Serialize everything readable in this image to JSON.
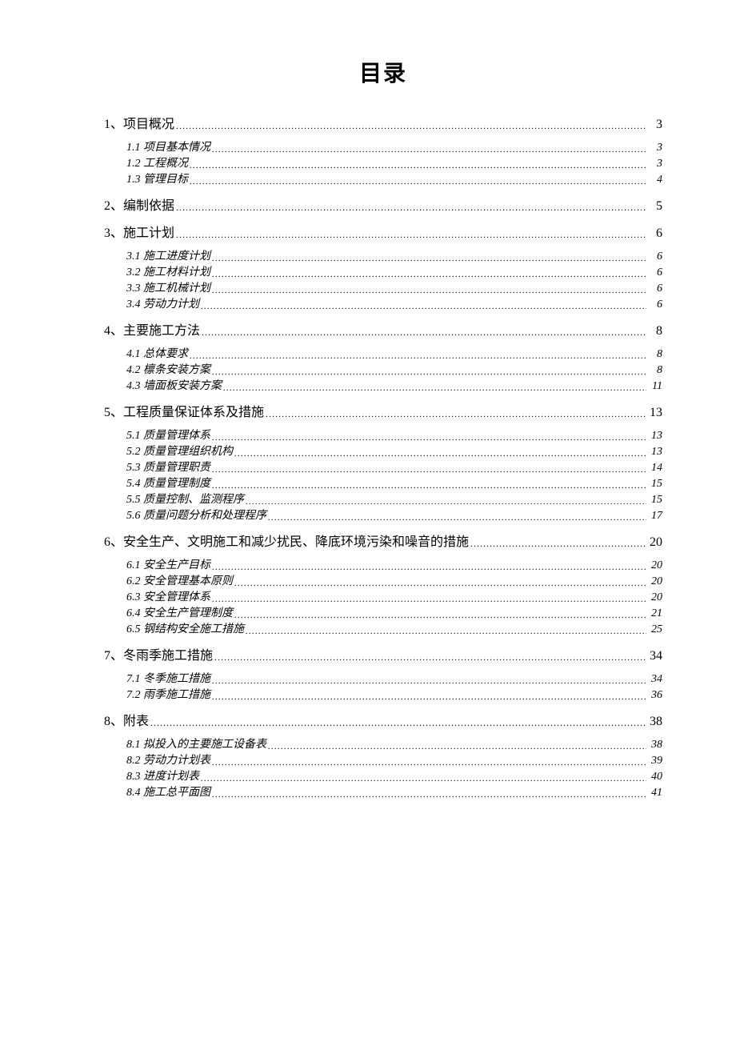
{
  "title": "目录",
  "toc": [
    {
      "level": 1,
      "label": "1、项目概况",
      "page": "3"
    },
    {
      "level": 2,
      "label": "1.1 项目基本情况",
      "page": "3",
      "blockstart": true
    },
    {
      "level": 2,
      "label": "1.2 工程概况",
      "page": "3"
    },
    {
      "level": 2,
      "label": "1.3 管理目标",
      "page": "4"
    },
    {
      "level": 1,
      "label": "2、编制依据",
      "page": "5"
    },
    {
      "level": 1,
      "label": "3、施工计划",
      "page": "6"
    },
    {
      "level": 2,
      "label": "3.1 施工进度计划",
      "page": "6",
      "blockstart": true
    },
    {
      "level": 2,
      "label": "3.2 施工材料计划",
      "page": "6"
    },
    {
      "level": 2,
      "label": "3.3 施工机械计划",
      "page": "6"
    },
    {
      "level": 2,
      "label": "3.4 劳动力计划",
      "page": "6"
    },
    {
      "level": 1,
      "label": "4、主要施工方法",
      "page": "8"
    },
    {
      "level": 2,
      "label": "4.1 总体要求",
      "page": "8",
      "blockstart": true
    },
    {
      "level": 2,
      "label": "4.2 檩条安装方案",
      "page": "8"
    },
    {
      "level": 2,
      "label": "4.3 墙面板安装方案",
      "page": "11"
    },
    {
      "level": 1,
      "label": "5、工程质量保证体系及措施",
      "page": "13"
    },
    {
      "level": 2,
      "label": "5.1 质量管理体系",
      "page": "13",
      "blockstart": true
    },
    {
      "level": 2,
      "label": "5.2 质量管理组织机构",
      "page": "13"
    },
    {
      "level": 2,
      "label": "5.3 质量管理职责",
      "page": "14"
    },
    {
      "level": 2,
      "label": "5.4 质量管理制度",
      "page": "15"
    },
    {
      "level": 2,
      "label": "5.5 质量控制、监测程序",
      "page": "15"
    },
    {
      "level": 2,
      "label": "5.6 质量问题分析和处理程序",
      "page": "17"
    },
    {
      "level": 1,
      "label": "6、安全生产、文明施工和减少扰民、降底环境污染和噪音的措施",
      "page": "20"
    },
    {
      "level": 2,
      "label": "6.1 安全生产目标",
      "page": "20",
      "blockstart": true
    },
    {
      "level": 2,
      "label": "6.2 安全管理基本原则",
      "page": "20"
    },
    {
      "level": 2,
      "label": "6.3 安全管理体系",
      "page": "20"
    },
    {
      "level": 2,
      "label": "6.4 安全生产管理制度",
      "page": "21"
    },
    {
      "level": 2,
      "label": "6.5 钢结构安全施工措施",
      "page": "25"
    },
    {
      "level": 1,
      "label": "7、冬雨季施工措施",
      "page": "34"
    },
    {
      "level": 2,
      "label": "7.1 冬季施工措施",
      "page": "34",
      "blockstart": true
    },
    {
      "level": 2,
      "label": "7.2 雨季施工措施",
      "page": "36"
    },
    {
      "level": 1,
      "label": "8、附表",
      "page": "38"
    },
    {
      "level": 2,
      "label": "8.1 拟投入的主要施工设备表",
      "page": "38",
      "blockstart": true
    },
    {
      "level": 2,
      "label": "8.2 劳动力计划表",
      "page": "39"
    },
    {
      "level": 2,
      "label": "8.3 进度计划表",
      "page": "40"
    },
    {
      "level": 2,
      "label": "8.4 施工总平面图",
      "page": "41"
    }
  ]
}
